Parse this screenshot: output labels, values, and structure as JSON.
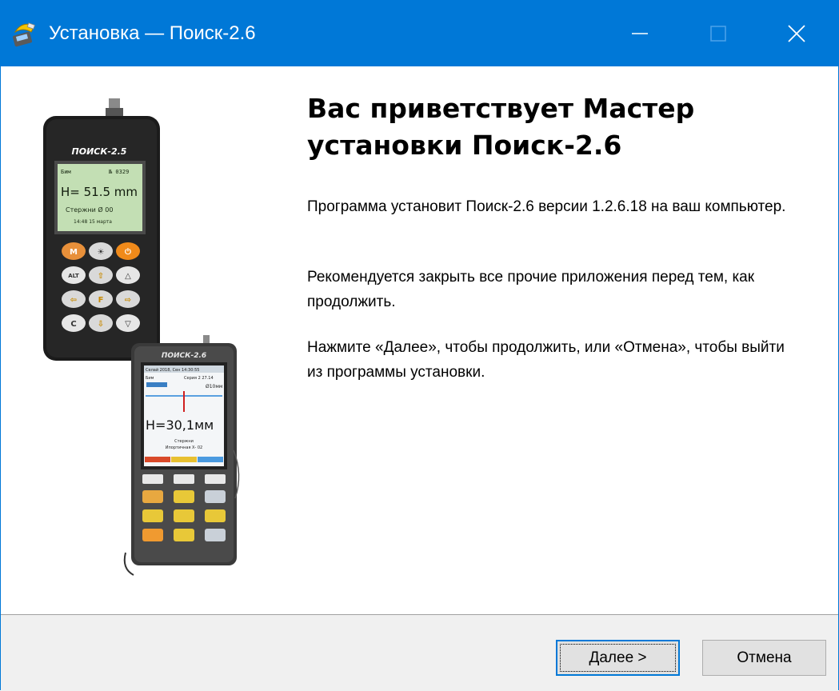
{
  "window": {
    "title": "Установка — Поиск-2.6",
    "accent_color": "#0078d7",
    "controls": [
      "minimize-icon",
      "maximize-icon",
      "close-icon"
    ]
  },
  "welcome": {
    "heading": "Вас приветствует Мастер установки Поиск-2.6",
    "paragraph1": "Программа установит Поиск-2.6 версии 1.2.6.18 на ваш компьютер.",
    "paragraph2": "Рекомендуется закрыть все прочие приложения перед тем, как продолжить.",
    "paragraph3": "Нажмите «Далее», чтобы продолжить, или «Отмена», чтобы выйти из программы установки."
  },
  "devices": {
    "device1_brand": "ПОИСК-2.5",
    "device1_screen": [
      "Бим",
      "№ 0329",
      "H= 51.5 mm",
      "Стержни Ø 00",
      "14:48 15 марта"
    ],
    "device1_keys": [
      "M",
      "☀",
      "⏻",
      "ALT",
      "⇧",
      "△",
      "⇦",
      "F",
      "⇨",
      "C",
      "⇩",
      "▽"
    ],
    "device2_brand": "ПОИСК-2.6",
    "device2_screen": [
      "Ceлай 2018, Сен 14:30:55",
      "Бим",
      "Серия 2 27.14",
      "Ø10мм",
      "H=30,1мм",
      "Стержни",
      "Ипортичная Х- 02"
    ]
  },
  "buttons": {
    "next_hotkey": "Д",
    "next_rest": "алее >",
    "cancel": "Отмена"
  }
}
